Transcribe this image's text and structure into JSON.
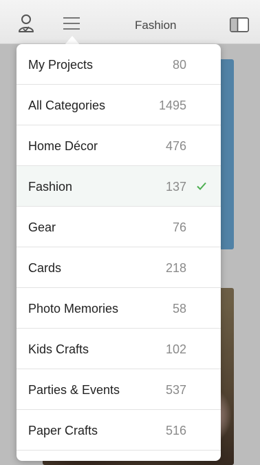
{
  "header": {
    "title": "Fashion",
    "icons": {
      "user": "user-icon",
      "menu": "hamburger-menu-icon",
      "layout": "split-view-icon"
    }
  },
  "categories": [
    {
      "label": "My Projects",
      "count": "80",
      "selected": false
    },
    {
      "label": "All Categories",
      "count": "1495",
      "selected": false
    },
    {
      "label": "Home Décor",
      "count": "476",
      "selected": false
    },
    {
      "label": "Fashion",
      "count": "137",
      "selected": true
    },
    {
      "label": "Gear",
      "count": "76",
      "selected": false
    },
    {
      "label": "Cards",
      "count": "218",
      "selected": false
    },
    {
      "label": "Photo Memories",
      "count": "58",
      "selected": false
    },
    {
      "label": "Kids Crafts",
      "count": "102",
      "selected": false
    },
    {
      "label": "Parties & Events",
      "count": "537",
      "selected": false
    },
    {
      "label": "Paper Crafts",
      "count": "516",
      "selected": false
    }
  ],
  "colors": {
    "check": "#4caf50",
    "card_blue": "#5d95bd"
  }
}
